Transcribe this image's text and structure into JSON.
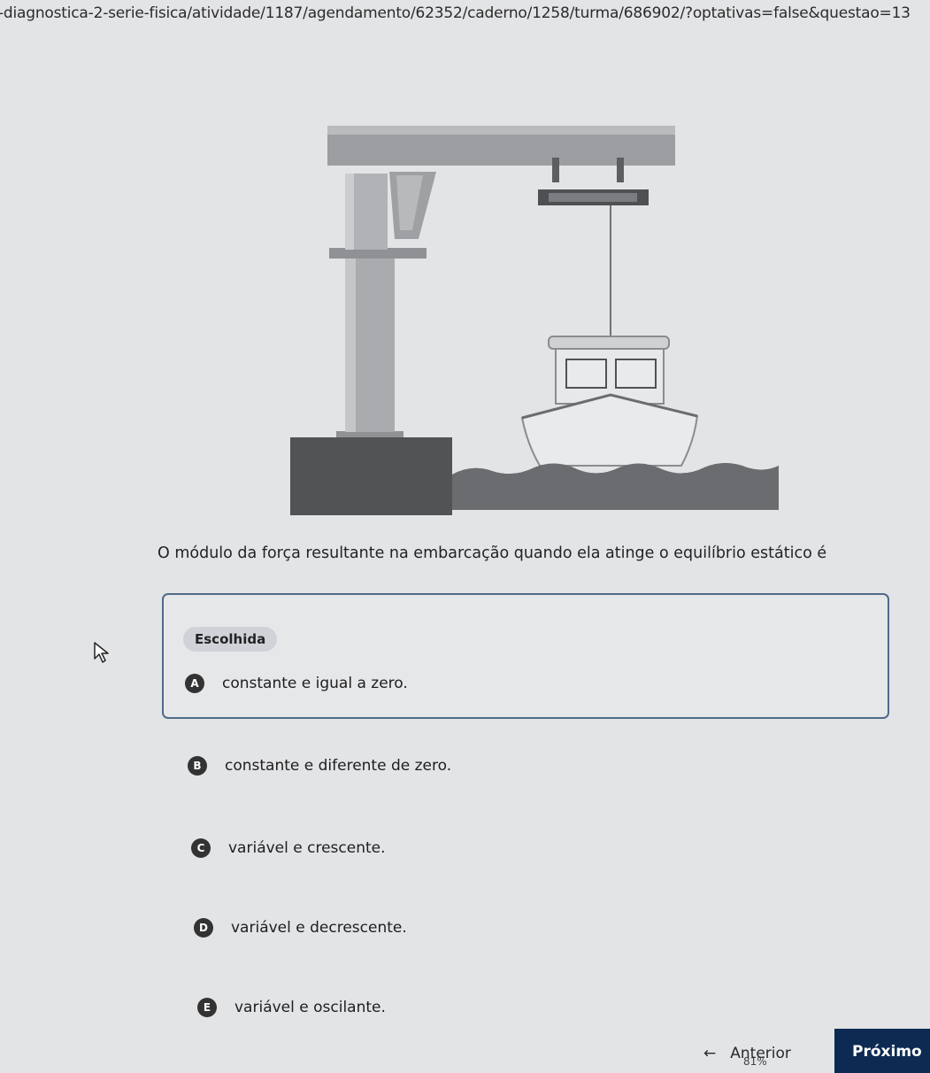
{
  "browser": {
    "url": "-diagnostica-2-serie-fisica/atividade/1187/agendamento/62352/caderno/1258/turma/686902/?optativas=false&questao=13"
  },
  "question": {
    "text": "O módulo da força resultante na embarcação quando ela atinge o equilíbrio estático é"
  },
  "selected_badge": "Escolhida",
  "options": [
    {
      "letter": "A",
      "text": "constante e igual a zero.",
      "selected": true
    },
    {
      "letter": "B",
      "text": "constante e diferente de zero.",
      "selected": false
    },
    {
      "letter": "C",
      "text": "variável e crescente.",
      "selected": false
    },
    {
      "letter": "D",
      "text": "variável e decrescente.",
      "selected": false
    },
    {
      "letter": "E",
      "text": "variável e oscilante.",
      "selected": false
    }
  ],
  "footer": {
    "progress": "81%",
    "prev_arrow": "←",
    "prev_label": "Anterior",
    "next_label": "Próximo"
  },
  "colors": {
    "accent": "#0d2b52",
    "selected_border": "#4f6a8a",
    "letter_badge": "#333333"
  },
  "icons": {
    "cursor": "cursor-arrow-icon",
    "prev": "arrow-left-icon"
  }
}
